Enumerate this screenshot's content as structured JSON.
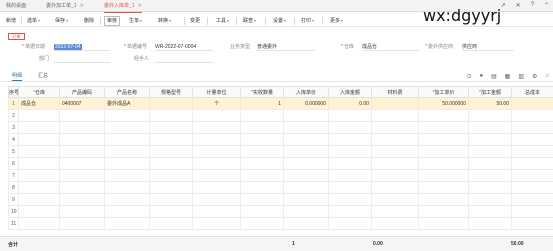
{
  "tabs": [
    {
      "label": "我的桌面",
      "active": false
    },
    {
      "label": "委外加工单_1",
      "active": false
    },
    {
      "label": "委外入库单_1",
      "active": true
    }
  ],
  "tab_tools": [
    "↗",
    "✕",
    "?",
    "⌃"
  ],
  "toolbar": {
    "items": [
      "新增",
      "选单",
      "保存",
      "删除",
      "审核",
      "生单",
      "转换",
      "变更",
      "工具",
      "联查",
      "设置",
      "打印",
      "更多"
    ]
  },
  "watermark": "wx:dgyyrj",
  "status_badge": "已审",
  "form": {
    "doc_date": {
      "label": "单据日期",
      "value": "2022-07-04"
    },
    "doc_no": {
      "label": "单据编号",
      "value": "WR-2022-07-0004"
    },
    "biz_type": {
      "label": "业务类型",
      "value": "普通委外"
    },
    "warehouse": {
      "label": "仓库",
      "value": "成品仓"
    },
    "supplier": {
      "label": "委外供应商",
      "value": "供应商"
    },
    "dept": {
      "label": "部门",
      "value": ""
    },
    "handler": {
      "label": "经手人",
      "value": ""
    }
  },
  "subtabs": [
    "明细",
    "汇总"
  ],
  "grid_tools": [
    "⊙",
    "♠",
    "▤",
    "▦",
    "▥",
    "⚙",
    "⌂"
  ],
  "grid": {
    "headers": [
      {
        "label": "序号",
        "required": false
      },
      {
        "label": "仓库",
        "required": true
      },
      {
        "label": "产品编码",
        "required": false
      },
      {
        "label": "产品名称",
        "required": false
      },
      {
        "label": "规格型号",
        "required": false
      },
      {
        "label": "计量单位",
        "required": false
      },
      {
        "label": "实收数量",
        "required": true
      },
      {
        "label": "入库单价",
        "required": false
      },
      {
        "label": "入库金额",
        "required": false
      },
      {
        "label": "材料费",
        "required": false
      },
      {
        "label": "加工单价",
        "required": true
      },
      {
        "label": "加工金额",
        "required": true
      },
      {
        "label": "总成本",
        "required": false
      }
    ],
    "rows": [
      [
        "1",
        "成品仓",
        "0400007",
        "委外成品A",
        "",
        "个",
        "1",
        "0.000000",
        "0.00",
        "",
        "50.000000",
        "50.00",
        ""
      ],
      [
        "2",
        "",
        "",
        "",
        "",
        "",
        "",
        "",
        "",
        "",
        "",
        "",
        ""
      ],
      [
        "3",
        "",
        "",
        "",
        "",
        "",
        "",
        "",
        "",
        "",
        "",
        "",
        ""
      ],
      [
        "4",
        "",
        "",
        "",
        "",
        "",
        "",
        "",
        "",
        "",
        "",
        "",
        ""
      ],
      [
        "5",
        "",
        "",
        "",
        "",
        "",
        "",
        "",
        "",
        "",
        "",
        "",
        ""
      ],
      [
        "6",
        "",
        "",
        "",
        "",
        "",
        "",
        "",
        "",
        "",
        "",
        "",
        ""
      ],
      [
        "7",
        "",
        "",
        "",
        "",
        "",
        "",
        "",
        "",
        "",
        "",
        "",
        ""
      ],
      [
        "8",
        "",
        "",
        "",
        "",
        "",
        "",
        "",
        "",
        "",
        "",
        "",
        ""
      ],
      [
        "9",
        "",
        "",
        "",
        "",
        "",
        "",
        "",
        "",
        "",
        "",
        "",
        ""
      ],
      [
        "10",
        "",
        "",
        "",
        "",
        "",
        "",
        "",
        "",
        "",
        "",
        "",
        ""
      ],
      [
        "11",
        "",
        "",
        "",
        "",
        "",
        "",
        "",
        "",
        "",
        "",
        "",
        ""
      ]
    ]
  },
  "footer": {
    "label": "合计",
    "qty": "1",
    "amount": "0.00",
    "process_amount": "50.00"
  },
  "colors": {
    "accent": "#e0533a",
    "selection_row": "#fff3d2",
    "link_blue": "#2a7ab9"
  }
}
